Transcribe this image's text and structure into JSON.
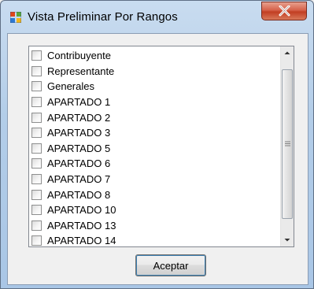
{
  "window": {
    "title": "Vista Preliminar Por Rangos",
    "icon": "windows-form-icon",
    "close_icon": "close-x-icon"
  },
  "list": {
    "items": [
      {
        "label": "Contribuyente",
        "checked": false
      },
      {
        "label": "Representante",
        "checked": false
      },
      {
        "label": "Generales",
        "checked": false
      },
      {
        "label": "APARTADO 1",
        "checked": false
      },
      {
        "label": "APARTADO 2",
        "checked": false
      },
      {
        "label": "APARTADO 3",
        "checked": false
      },
      {
        "label": "APARTADO 5",
        "checked": false
      },
      {
        "label": "APARTADO 6",
        "checked": false
      },
      {
        "label": "APARTADO 7",
        "checked": false
      },
      {
        "label": "APARTADO 8",
        "checked": false
      },
      {
        "label": "APARTADO 10",
        "checked": false
      },
      {
        "label": "APARTADO 13",
        "checked": false
      },
      {
        "label": "APARTADO 14",
        "checked": false
      }
    ]
  },
  "buttons": {
    "ok_label": "Aceptar"
  }
}
